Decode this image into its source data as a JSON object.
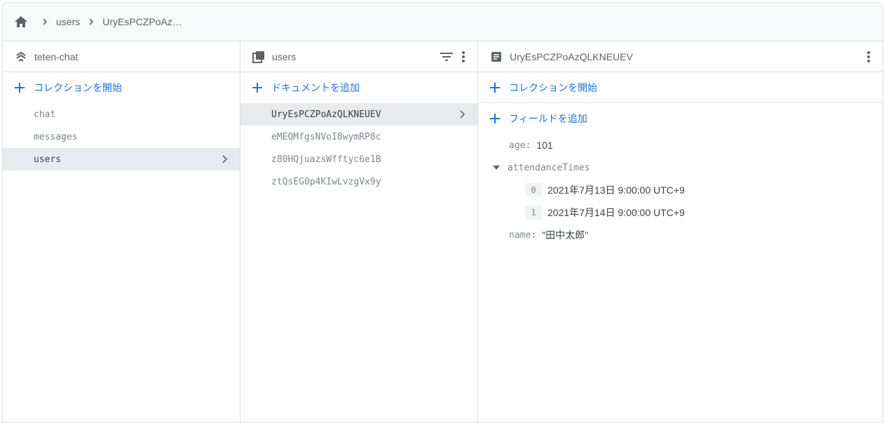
{
  "breadcrumb": {
    "home_icon": "home-icon",
    "items": [
      "users",
      "UryEsPCZPoAz…"
    ]
  },
  "colors": {
    "accent": "#1a73e8",
    "selected_row": "#e8eaed",
    "border": "#dadce0",
    "text_muted": "#5f6368"
  },
  "root_panel": {
    "title": "teten-chat",
    "icon": "firestore-icon",
    "add_label": "コレクションを開始",
    "collections": [
      "chat",
      "messages",
      "users"
    ],
    "selected": "users"
  },
  "collection_panel": {
    "title": "users",
    "icon": "collection-icon",
    "add_label": "ドキュメントを追加",
    "documents": [
      "UryEsPCZPoAzQLKNEUEV",
      "eMEQMfgsNVoI8wymRP8c",
      "z80HQjuazsWfftyc6e1B",
      "ztQsEG0p4KIwLvzgVx9y"
    ],
    "selected": "UryEsPCZPoAzQLKNEUEV"
  },
  "document_panel": {
    "title": "UryEsPCZPoAzQLKNEUEV",
    "icon": "document-icon",
    "add_collection_label": "コレクションを開始",
    "add_field_label": "フィールドを追加",
    "fields": {
      "age_key": "age",
      "age_value": "101",
      "attendance_key": "attendanceTimes",
      "attendance_items": [
        {
          "index": "0",
          "value": "2021年7月13日 9:00:00 UTC+9"
        },
        {
          "index": "1",
          "value": "2021年7月14日 9:00:00 UTC+9"
        }
      ],
      "name_key": "name",
      "name_value": "\"田中太郎\""
    }
  }
}
